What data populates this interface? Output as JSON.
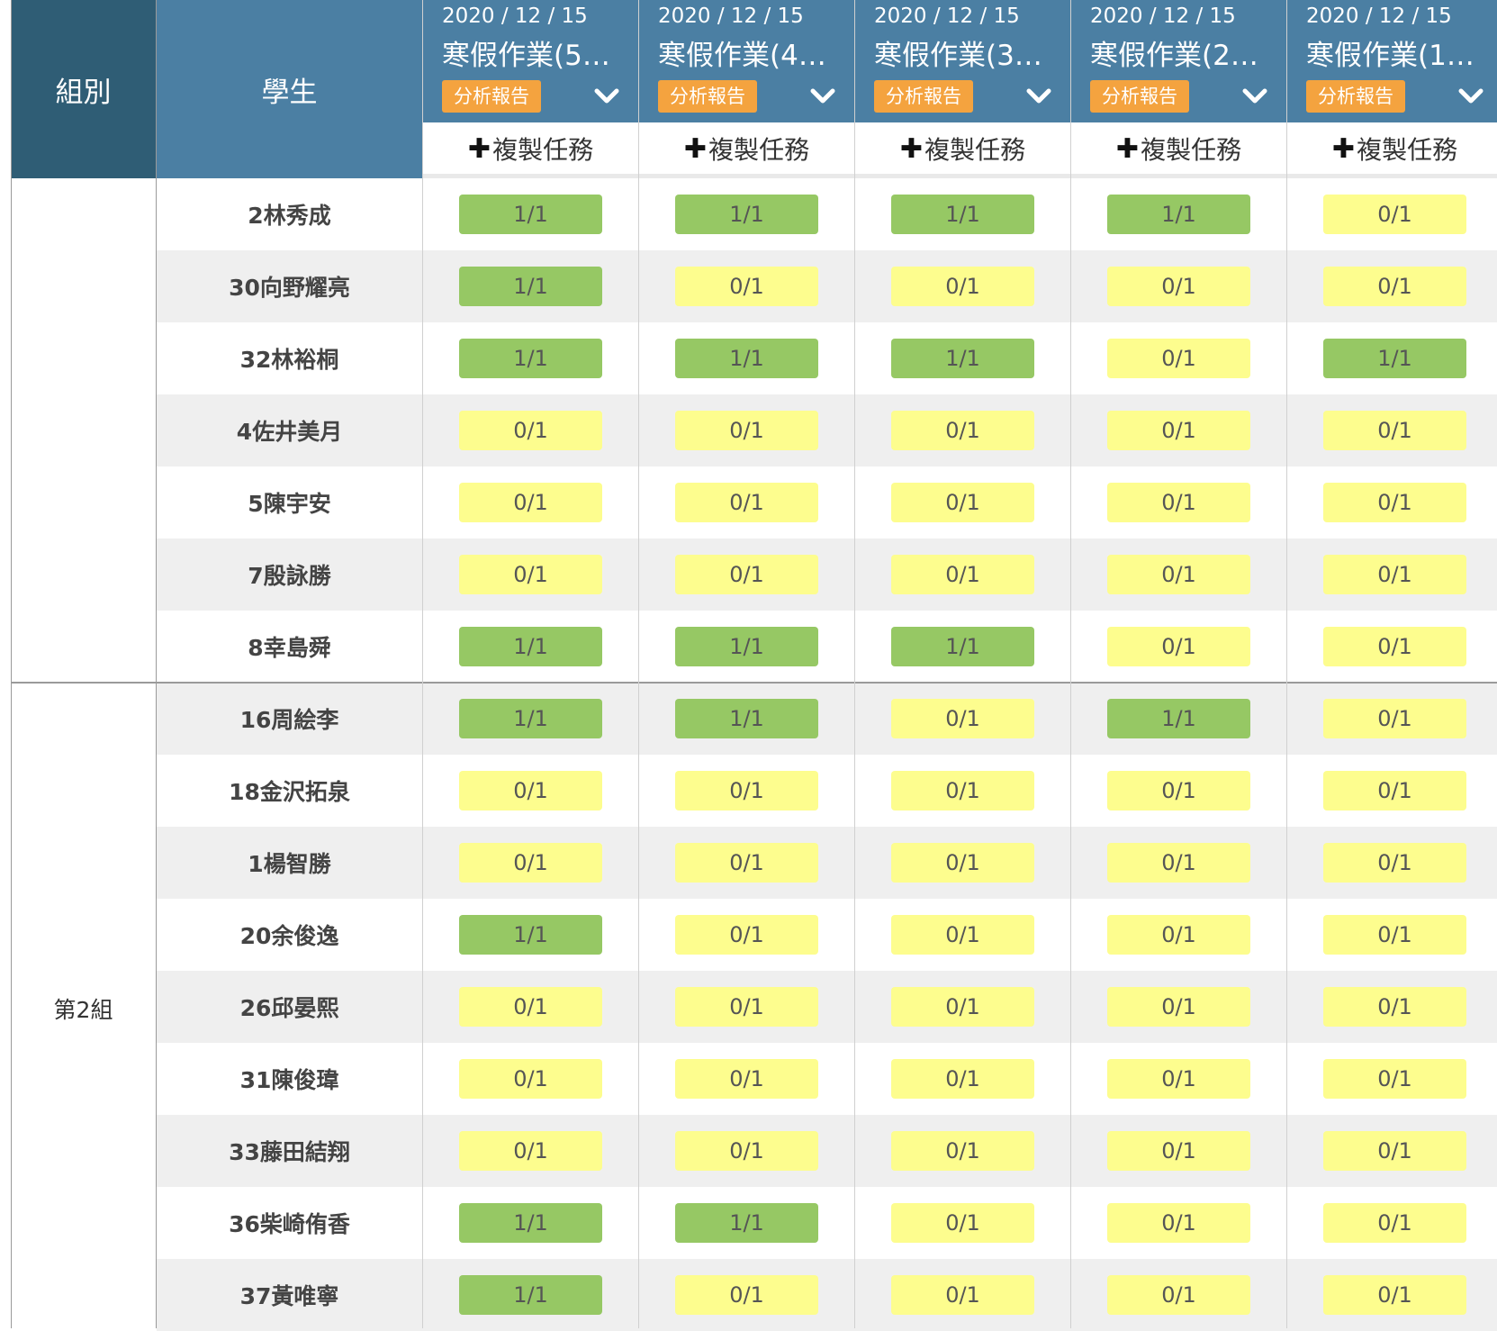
{
  "headers": {
    "group": "組別",
    "student": "學生"
  },
  "assignments": [
    {
      "date": "2020 / 12 / 15",
      "title": "寒假作業(5…",
      "report": "分析報告",
      "copy": "複製任務"
    },
    {
      "date": "2020 / 12 / 15",
      "title": "寒假作業(4…",
      "report": "分析報告",
      "copy": "複製任務"
    },
    {
      "date": "2020 / 12 / 15",
      "title": "寒假作業(3…",
      "report": "分析報告",
      "copy": "複製任務"
    },
    {
      "date": "2020 / 12 / 15",
      "title": "寒假作業(2…",
      "report": "分析報告",
      "copy": "複製任務"
    },
    {
      "date": "2020 / 12 / 15",
      "title": "寒假作業(1…",
      "report": "分析報告",
      "copy": "複製任務"
    }
  ],
  "groups": [
    {
      "name": "",
      "students": [
        {
          "name": "2林秀成",
          "scores": [
            "1/1",
            "1/1",
            "1/1",
            "1/1",
            "0/1"
          ]
        },
        {
          "name": "30向野耀亮",
          "scores": [
            "1/1",
            "0/1",
            "0/1",
            "0/1",
            "0/1"
          ]
        },
        {
          "name": "32林裕桐",
          "scores": [
            "1/1",
            "1/1",
            "1/1",
            "0/1",
            "1/1"
          ]
        },
        {
          "name": "4佐井美月",
          "scores": [
            "0/1",
            "0/1",
            "0/1",
            "0/1",
            "0/1"
          ]
        },
        {
          "name": "5陳宇安",
          "scores": [
            "0/1",
            "0/1",
            "0/1",
            "0/1",
            "0/1"
          ]
        },
        {
          "name": "7殷詠勝",
          "scores": [
            "0/1",
            "0/1",
            "0/1",
            "0/1",
            "0/1"
          ]
        },
        {
          "name": "8幸島舜",
          "scores": [
            "1/1",
            "1/1",
            "1/1",
            "0/1",
            "0/1"
          ]
        }
      ]
    },
    {
      "name": "第2組",
      "students": [
        {
          "name": "16周絵李",
          "scores": [
            "1/1",
            "1/1",
            "0/1",
            "1/1",
            "0/1"
          ]
        },
        {
          "name": "18金沢拓泉",
          "scores": [
            "0/1",
            "0/1",
            "0/1",
            "0/1",
            "0/1"
          ]
        },
        {
          "name": "1楊智勝",
          "scores": [
            "0/1",
            "0/1",
            "0/1",
            "0/1",
            "0/1"
          ]
        },
        {
          "name": "20余俊逸",
          "scores": [
            "1/1",
            "0/1",
            "0/1",
            "0/1",
            "0/1"
          ]
        },
        {
          "name": "26邱晏熙",
          "scores": [
            "0/1",
            "0/1",
            "0/1",
            "0/1",
            "0/1"
          ]
        },
        {
          "name": "31陳俊瑋",
          "scores": [
            "0/1",
            "0/1",
            "0/1",
            "0/1",
            "0/1"
          ]
        },
        {
          "name": "33藤田結翔",
          "scores": [
            "0/1",
            "0/1",
            "0/1",
            "0/1",
            "0/1"
          ]
        },
        {
          "name": "36柴崎侑香",
          "scores": [
            "1/1",
            "1/1",
            "0/1",
            "0/1",
            "0/1"
          ]
        },
        {
          "name": "37黃唯寧",
          "scores": [
            "1/1",
            "0/1",
            "0/1",
            "0/1",
            "0/1"
          ]
        }
      ]
    }
  ],
  "colors": {
    "group_header": "#2f5d75",
    "header": "#4b7fa3",
    "report_button": "#f4a33f",
    "complete": "#96c864",
    "incomplete": "#fdfd8e"
  },
  "icons": {
    "dropdown": "chevron-down-icon",
    "copy": "plus-icon"
  }
}
